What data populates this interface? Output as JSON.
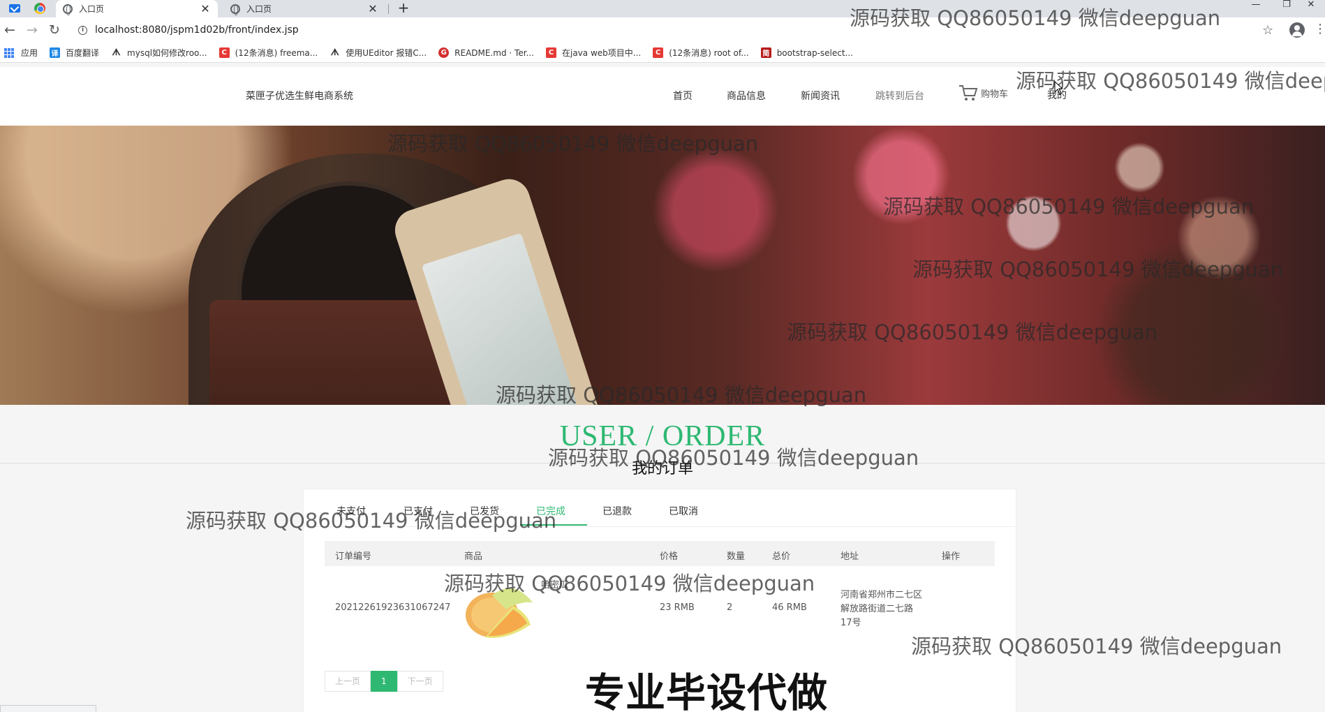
{
  "browser": {
    "tabs": [
      {
        "title": "入口页",
        "close": "✕"
      },
      {
        "title": "入口页",
        "close": "✕"
      }
    ],
    "new_tab": "+",
    "url": "localhost:8080/jspm1d02b/front/index.jsp",
    "window_controls": {
      "minimize": "—",
      "maximize": "❐",
      "close": "✕"
    },
    "bookmarks": [
      {
        "label": "应用",
        "icon": "apps-grid-icon"
      },
      {
        "label": "百度翻译",
        "icon": "baidu-translate-icon"
      },
      {
        "label": "mysql如何修改roo...",
        "icon": "wing-icon"
      },
      {
        "label": "(12条消息) freema...",
        "icon": "csdn-icon"
      },
      {
        "label": "使用UEditor 报错C...",
        "icon": "wing-icon"
      },
      {
        "label": "README.md · Ter...",
        "icon": "gitee-icon"
      },
      {
        "label": "在java web项目中...",
        "icon": "csdn-icon"
      },
      {
        "label": "(12条消息) root of...",
        "icon": "csdn-icon"
      },
      {
        "label": "bootstrap-select...",
        "icon": "jianshu-icon"
      }
    ]
  },
  "site": {
    "logo": "菜匣子优选生鲜电商系统",
    "nav": [
      "首页",
      "商品信息",
      "新闻资讯",
      "跳转到后台"
    ],
    "cart": "购物车",
    "my": "我的"
  },
  "section": {
    "title_en": "USER / ORDER",
    "title_zh": "我的订单"
  },
  "order_tabs": {
    "items": [
      "未支付",
      "已支付",
      "已发货",
      "已完成",
      "已退款",
      "已取消"
    ],
    "active_index": 3
  },
  "orders": {
    "columns": [
      "订单编号",
      "商品",
      "价格",
      "数量",
      "总价",
      "地址",
      "操作"
    ],
    "rows": [
      {
        "order_no": "20212261923631067247",
        "product": "哈密瓜",
        "price": "23 RMB",
        "quantity": "2",
        "total": "46 RMB",
        "address": "河南省郑州市二七区解放路街道二七路17号",
        "action": ""
      }
    ]
  },
  "pager": {
    "prev": "上一页",
    "current": "1",
    "next": "下一页"
  },
  "overlay": {
    "watermarks": [
      "源码获取 QQ86050149 微信deepguan",
      "源码获取 QQ86050149 微信deepguan",
      "源码获取 QQ86050149 微信deepguan",
      "源码获取 QQ86050149 微信deepguan",
      "源码获取 QQ86050149 微信deepguan",
      "源码获取 QQ86050149 微信deepguan",
      "源码获取 QQ86050149 微信deepguan",
      "源码获取 QQ86050149 微信deepguan",
      "源码获取 QQ86050149 微信deepguan",
      "源码获取 QQ86050149 微信deepguan",
      "源码获取 QQ86050149 微信deepguan"
    ],
    "promo": "专业毕设代做"
  },
  "colors": {
    "accent": "#2eb872",
    "header_bg": "#ffffff",
    "page_bg": "#f5f5f5"
  }
}
